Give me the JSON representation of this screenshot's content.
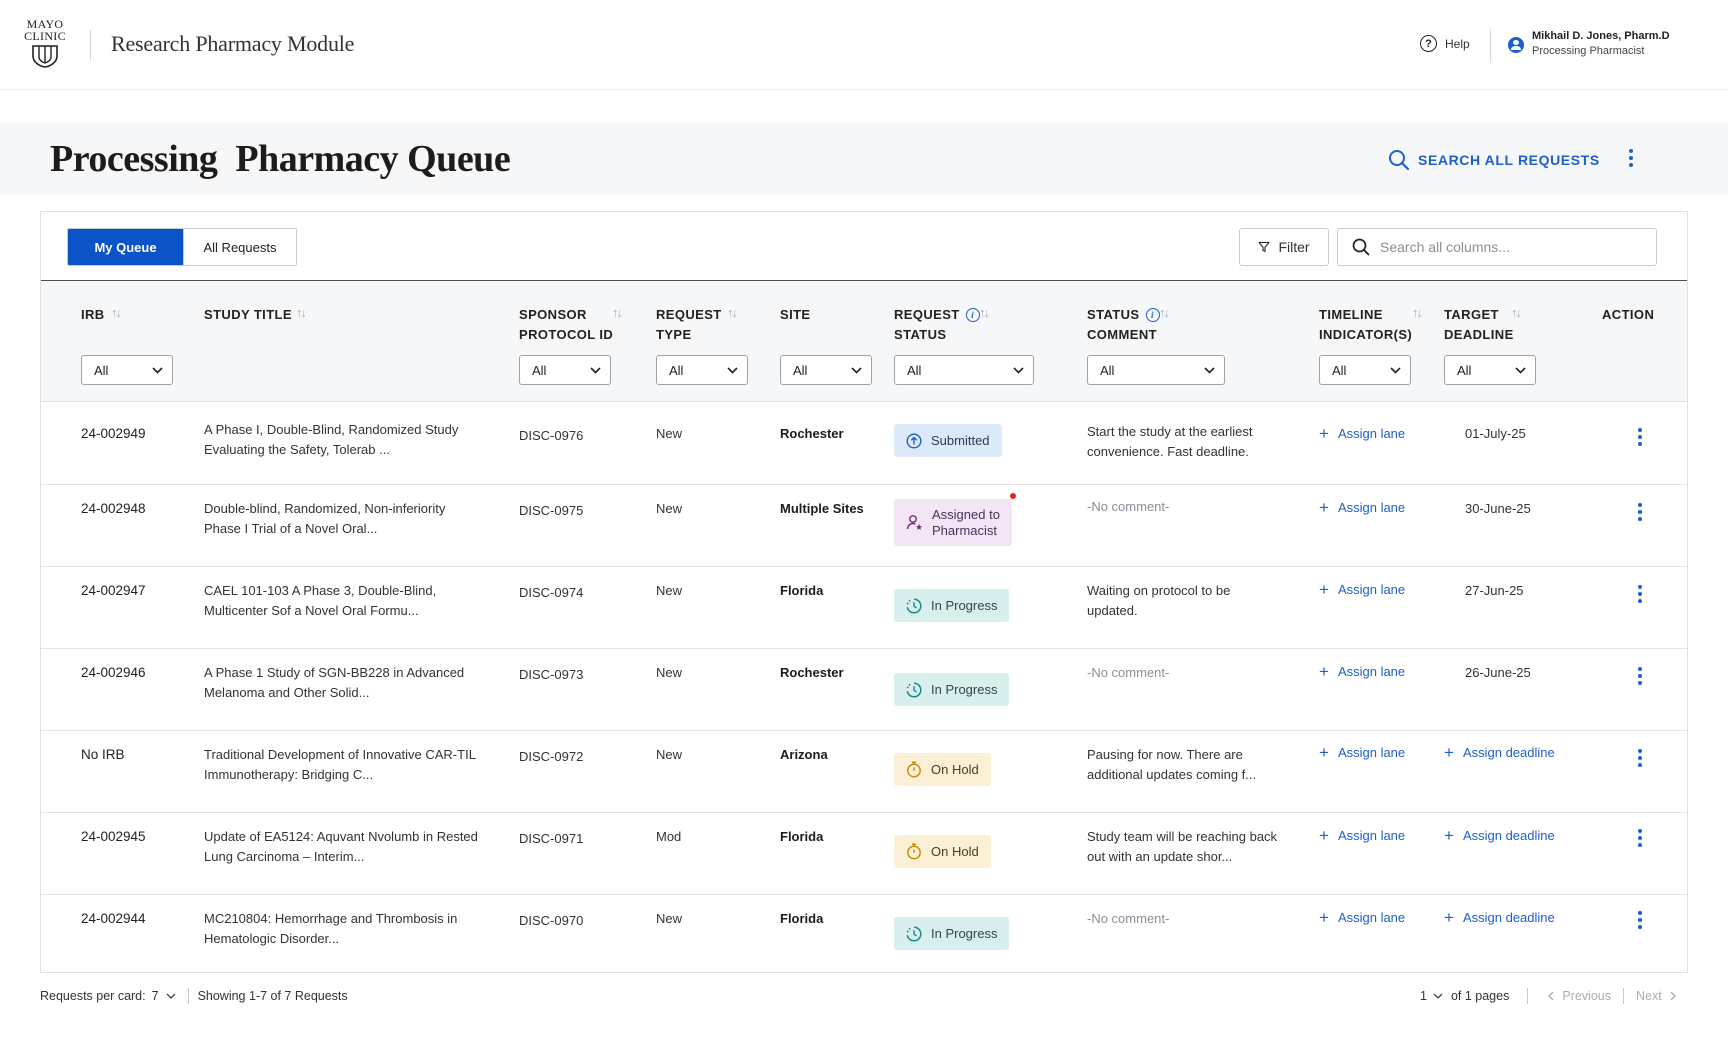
{
  "app": {
    "logo_line1": "MAYO",
    "logo_line2": "CLINIC",
    "title": "Research Pharmacy Module",
    "help_label": "Help",
    "user_name": "Mikhail D. Jones, Pharm.D",
    "user_role": "Processing Pharmacist"
  },
  "page": {
    "title": "Processing  Pharmacy Queue",
    "search_all_label": "SEARCH ALL REQUESTS"
  },
  "toolbar": {
    "tab_my_queue": "My Queue",
    "tab_all_requests": "All Requests",
    "filter_label": "Filter",
    "search_placeholder": "Search all columns..."
  },
  "columns": {
    "irb": "IRB",
    "study_title": "STUDY TITLE",
    "sponsor_1": "SPONSOR",
    "sponsor_2": "PROTOCOL ID",
    "request_type_1": "REQUEST",
    "request_type_2": "TYPE",
    "site": "SITE",
    "request_status_1": "REQUEST",
    "request_status_2": "STATUS",
    "status_comment_1": "STATUS",
    "status_comment_2": "COMMENT",
    "timeline_1": "TIMELINE",
    "timeline_2": "INDICATOR(S)",
    "target_1": "TARGET",
    "target_2": "DEADLINE",
    "action": "ACTION"
  },
  "filters": {
    "irb": "All",
    "sponsor": "All",
    "request_type": "All",
    "site": "All",
    "request_status": "All",
    "status_comment": "All",
    "timeline": "All",
    "target": "All"
  },
  "rows": [
    {
      "irb": "24-002949",
      "title1": "A Phase I, Double-Blind, Randomized Study",
      "title2": "Evaluating the Safety, Tolerab ...",
      "protocol": "DISC-0976",
      "type": "New",
      "site": "Rochester",
      "status": "Submitted",
      "comment1": "Start the study at the earliest",
      "comment2": "convenience. Fast deadline.",
      "lane": "Assign lane",
      "deadline": "01-July-25"
    },
    {
      "irb": "24-002948",
      "title1": "Double-blind, Randomized, Non-inferiority",
      "title2": "Phase I Trial of a Novel Oral...",
      "protocol": "DISC-0975",
      "type": "New",
      "site": "Multiple Sites",
      "status1": "Assigned to",
      "status2": "Pharmacist",
      "comment1": "-No comment-",
      "lane": "Assign lane",
      "deadline": "30-June-25"
    },
    {
      "irb": "24-002947",
      "title1": "CAEL 101-103 A Phase 3, Double-Blind,",
      "title2": "Multicenter Sof a Novel Oral Formu...",
      "protocol": "DISC-0974",
      "type": "New",
      "site": "Florida",
      "status": "In Progress",
      "comment1": "Waiting on protocol to be",
      "comment2": "updated.",
      "lane": "Assign lane",
      "deadline": "27-Jun-25"
    },
    {
      "irb": "24-002946",
      "title1": "A Phase 1 Study of SGN-BB228 in Advanced",
      "title2": "Melanoma and Other Solid...",
      "protocol": "DISC-0973",
      "type": "New",
      "site": "Rochester",
      "status": "In Progress",
      "comment1": "-No comment-",
      "lane": "Assign lane",
      "deadline": "26-June-25"
    },
    {
      "irb": "No IRB",
      "title1": "Traditional Development of Innovative CAR-TIL",
      "title2": "Immunotherapy: Bridging C...",
      "protocol": "DISC-0972",
      "type": "New",
      "site": "Arizona",
      "status": "On Hold",
      "comment1": "Pausing for now. There are",
      "comment2": "additional updates coming f...",
      "lane": "Assign lane",
      "deadline": "Assign deadline"
    },
    {
      "irb": "24-002945",
      "title1": "Update of EA5124: Aquvant Nvolumb in Rested",
      "title2": "Lung Carcinoma – Interim...",
      "protocol": "DISC-0971",
      "type": "Mod",
      "site": "Florida",
      "status": "On Hold",
      "comment1": "Study team will be reaching back",
      "comment2": "out with an update shor...",
      "lane": "Assign lane",
      "deadline": "Assign deadline"
    },
    {
      "irb": "24-002944",
      "title1": "MC210804: Hemorrhage and Thrombosis in",
      "title2": "Hematologic Disorder...",
      "protocol": "DISC-0970",
      "type": "New",
      "site": "Florida",
      "status": "In Progress",
      "comment1": "-No comment-",
      "lane": "Assign lane",
      "deadline": "Assign deadline"
    }
  ],
  "footer": {
    "per_card_label": "Requests per card:",
    "per_card_value": "7",
    "showing": "Showing 1-7 of 7 Requests",
    "page_value": "1",
    "of_pages": "of 1 pages",
    "previous": "Previous",
    "next": "Next"
  },
  "colors": {
    "primary": "#0b54c7",
    "link": "#1d5fcf",
    "submitted_bg": "#dce9f8",
    "assigned_bg": "#f3e4f6",
    "progress_bg": "#d9efee",
    "hold_bg": "#fbf0d6"
  }
}
